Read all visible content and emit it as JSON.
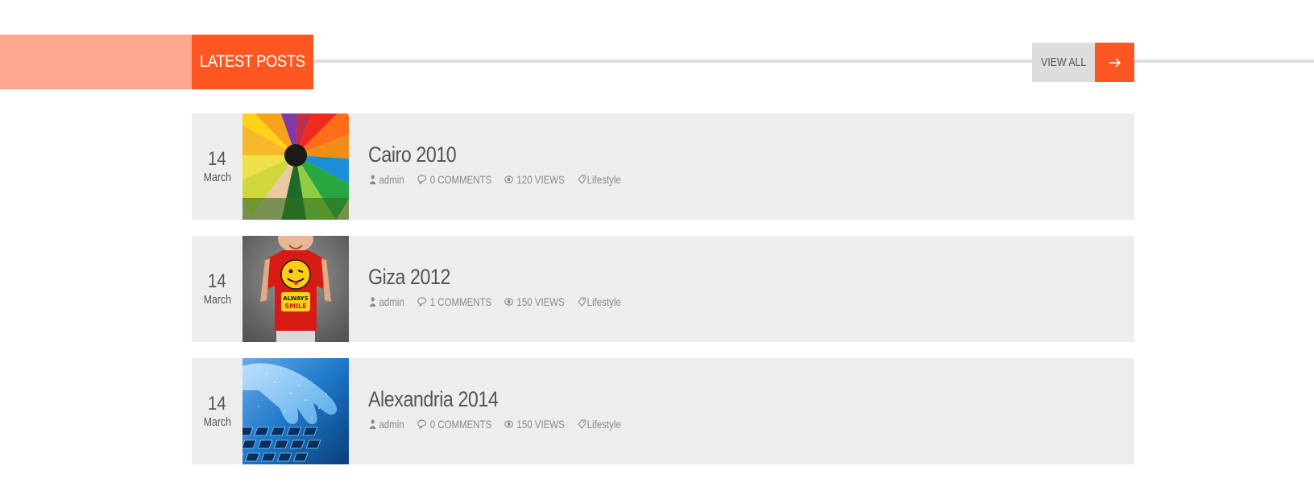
{
  "section": {
    "title": "LATEST POSTS",
    "view_all_label": "VIEW ALL",
    "accent_color": "#ff5722",
    "accent_light_color": "#ffa88d"
  },
  "posts": [
    {
      "day": "14",
      "month": "March",
      "title": "Cairo 2010",
      "author": "admin",
      "comments": "0 COMMENTS",
      "views": "120 VIEWS",
      "category": "Lifestyle",
      "thumbnail": "colored-pencils-image"
    },
    {
      "day": "14",
      "month": "March",
      "title": "Giza 2012",
      "author": "admin",
      "comments": "1 COMMENTS",
      "views": "150 VIEWS",
      "category": "Lifestyle",
      "thumbnail": "kid-smile-tshirt-image"
    },
    {
      "day": "14",
      "month": "March",
      "title": "Alexandria 2014",
      "author": "admin",
      "comments": "0 COMMENTS",
      "views": "150 VIEWS",
      "category": "Lifestyle",
      "thumbnail": "hand-on-keyboard-image"
    }
  ]
}
